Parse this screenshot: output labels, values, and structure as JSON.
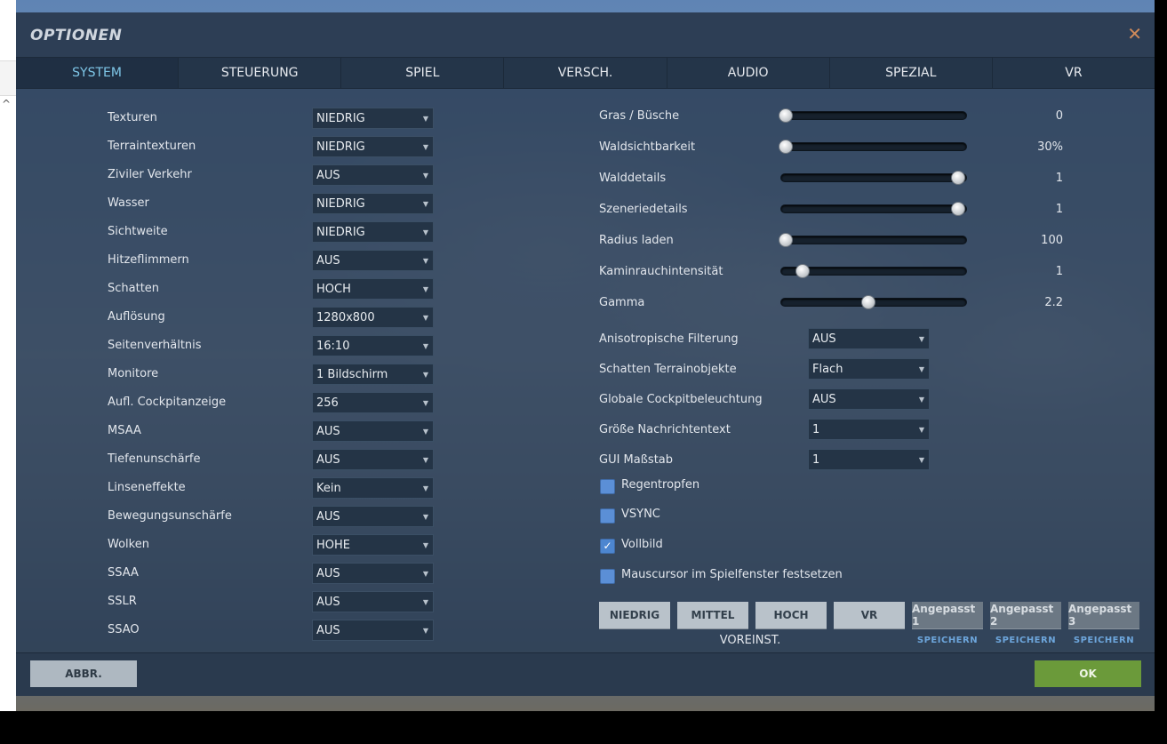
{
  "dialog": {
    "title": "OPTIONEN",
    "close_icon": "close-icon"
  },
  "tabs": [
    {
      "label": "SYSTEM",
      "active": true
    },
    {
      "label": "STEUERUNG"
    },
    {
      "label": "SPIEL"
    },
    {
      "label": "VERSCH."
    },
    {
      "label": "AUDIO"
    },
    {
      "label": "SPEZIAL"
    },
    {
      "label": "VR"
    }
  ],
  "left_settings": [
    {
      "label": "Texturen",
      "value": "NIEDRIG"
    },
    {
      "label": "Terraintexturen",
      "value": "NIEDRIG"
    },
    {
      "label": "Ziviler Verkehr",
      "value": "AUS"
    },
    {
      "label": "Wasser",
      "value": "NIEDRIG"
    },
    {
      "label": "Sichtweite",
      "value": "NIEDRIG"
    },
    {
      "label": "Hitzeflimmern",
      "value": "AUS"
    },
    {
      "label": "Schatten",
      "value": "HOCH"
    },
    {
      "label": "Auflösung",
      "value": "1280x800"
    },
    {
      "label": "Seitenverhältnis",
      "value": "16:10"
    },
    {
      "label": "Monitore",
      "value": "1 Bildschirm"
    },
    {
      "label": "Aufl. Cockpitanzeige",
      "value": "256"
    },
    {
      "label": "MSAA",
      "value": "AUS"
    },
    {
      "label": "Tiefenunschärfe",
      "value": "AUS"
    },
    {
      "label": "Linseneffekte",
      "value": "Kein"
    },
    {
      "label": "Bewegungsunschärfe",
      "value": "AUS"
    },
    {
      "label": "Wolken",
      "value": "HOHE"
    },
    {
      "label": "SSAA",
      "value": "AUS"
    },
    {
      "label": "SSLR",
      "value": "AUS"
    },
    {
      "label": "SSAO",
      "value": "AUS"
    }
  ],
  "sliders": [
    {
      "label": "Gras / Büsche",
      "value": "0",
      "level": 0.0
    },
    {
      "label": "Waldsichtbarkeit",
      "value": "30%",
      "level": 0.0
    },
    {
      "label": "Walddetails",
      "value": "1",
      "level": 1.0
    },
    {
      "label": "Szeneriedetails",
      "value": "1",
      "level": 1.0
    },
    {
      "label": "Radius laden",
      "value": "100",
      "level": 0.0
    },
    {
      "label": "Kaminrauchintensität",
      "value": "1",
      "level": 0.1
    },
    {
      "label": "Gamma",
      "value": "2.2",
      "level": 0.48
    }
  ],
  "right_selects": [
    {
      "label": "Anisotropische Filterung",
      "value": "AUS"
    },
    {
      "label": "Schatten Terrainobjekte",
      "value": "Flach"
    },
    {
      "label": "Globale Cockpitbeleuchtung",
      "value": "AUS"
    },
    {
      "label": "Größe Nachrichtentext",
      "value": "1"
    },
    {
      "label": "GUI Maßstab",
      "value": "1"
    }
  ],
  "checkboxes": [
    {
      "label": "Regentropfen",
      "checked": false
    },
    {
      "label": "VSYNC",
      "checked": false
    },
    {
      "label": "Vollbild",
      "checked": true
    },
    {
      "label": "Mauscursor im Spielfenster festsetzen",
      "checked": false
    }
  ],
  "presets": {
    "buttons": [
      "NIEDRIG",
      "MITTEL",
      "HOCH",
      "VR"
    ],
    "caption": "VOREINST.",
    "custom": [
      {
        "label": "Angepasst 1",
        "save": "SPEICHERN"
      },
      {
        "label": "Angepasst 2",
        "save": "SPEICHERN"
      },
      {
        "label": "Angepasst 3",
        "save": "SPEICHERN"
      }
    ]
  },
  "footer": {
    "cancel_label": "ABBR.",
    "ok_label": "OK"
  },
  "colors": {
    "accent_tab": "#7fc7e8",
    "ok": "#6b9a3a",
    "checkbox": "#4d86d0"
  }
}
